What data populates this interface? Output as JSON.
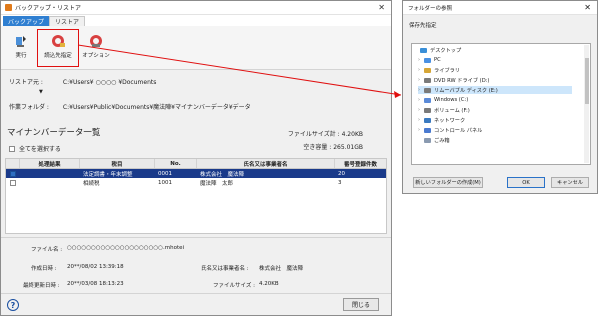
{
  "main_window": {
    "title": "バックアップ・リストア",
    "tabs": [
      {
        "label": "バックアップ",
        "active": false
      },
      {
        "label": "リストア",
        "active": true
      }
    ],
    "ribbon": {
      "execute_label": "実行",
      "read_dest_label": "読込先指定",
      "option_label": "オプション"
    },
    "restore_source": {
      "label": "リストア元 :",
      "value": "C:¥Users¥ ○○○○ ¥Documents"
    },
    "work_folder": {
      "label": "作業フォルダ :",
      "value": "C:¥Users¥Public¥Documents¥魔法陣¥マイナンバーデータ¥データ"
    },
    "section_title": "マイナンバーデータ一覧",
    "file_size_total": "ファイルサイズ計 : 4.20KB",
    "free_space": "空き容量 : 265.01GB",
    "select_all_label": "全てを選択する",
    "table": {
      "columns": [
        "処理結果",
        "税目",
        "No.",
        "氏名又は事業者名",
        "番号登録件数"
      ],
      "rows": [
        {
          "checked": true,
          "result": "",
          "tax": "法定調書・年末調整",
          "no": "0001",
          "name": "株式会社　魔法陣",
          "count": "20",
          "selected": true
        },
        {
          "checked": false,
          "result": "",
          "tax": "相続税",
          "no": "1001",
          "name": "魔法陣　太郎",
          "count": "3",
          "selected": false
        }
      ]
    },
    "details": {
      "file_name_label": "ファイル名 :",
      "file_name_value": "○○○○○○○○○○○○○○○○○○○○.mhotei",
      "created_label": "作成日時 :",
      "created_value": "20**/08/02 13:39:18",
      "modified_label": "最終更新日時 :",
      "modified_value": "20**/03/08 18:13:23",
      "owner_label": "氏名又は事業者名 :",
      "owner_value": "株式会社　魔法陣",
      "size_label": "ファイルサイズ :",
      "size_value": "4.20KB"
    },
    "help_label": "?",
    "close_label": "閉じる"
  },
  "folder_dialog": {
    "title": "フォルダーの参照",
    "subtitle": "保存先指定",
    "tree": [
      {
        "label": "デスクトップ",
        "caret": "",
        "color": "#3a8fd8",
        "selected": false
      },
      {
        "label": "PC",
        "caret": "›",
        "color": "#4a90e2",
        "selected": false
      },
      {
        "label": "ライブラリ",
        "caret": "›",
        "color": "#d6a636",
        "selected": false
      },
      {
        "label": "DVD RW ドライブ (D:)",
        "caret": "›",
        "color": "#7a7a7a",
        "selected": false
      },
      {
        "label": "リムーバブル ディスク (E:)",
        "caret": "›",
        "color": "#7a7a7a",
        "selected": true
      },
      {
        "label": "Windows (C:)",
        "caret": "›",
        "color": "#5a8ad8",
        "selected": false
      },
      {
        "label": "ボリューム (F:)",
        "caret": "›",
        "color": "#7a7a7a",
        "selected": false
      },
      {
        "label": "ネットワーク",
        "caret": "›",
        "color": "#3a7ac0",
        "selected": false
      },
      {
        "label": "コントロール パネル",
        "caret": "›",
        "color": "#4a7ad0",
        "selected": false
      },
      {
        "label": "ごみ箱",
        "caret": "",
        "color": "#8a9ab0",
        "selected": false
      }
    ],
    "new_folder_label": "新しいフォルダーの作成(M)",
    "ok_label": "OK",
    "cancel_label": "キャンセル"
  },
  "colors": {
    "accent_tab": "#2f7fd1",
    "selected_row": "#1a3a8a",
    "highlight_box": "#e01010"
  }
}
